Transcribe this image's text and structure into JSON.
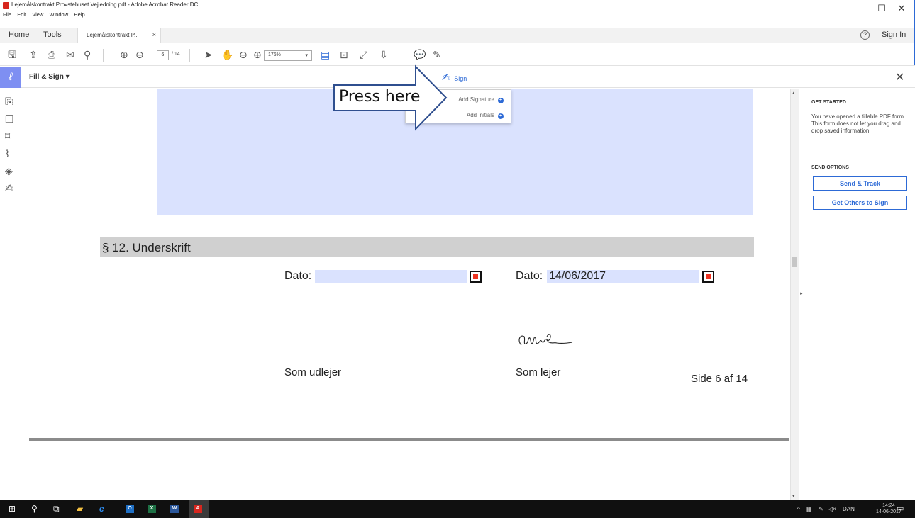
{
  "window": {
    "title": "Lejemålskontrakt Provstehuset Vejledning.pdf - Adobe Acrobat Reader DC",
    "min": "–",
    "max": "☐",
    "close": "✕"
  },
  "menu": [
    "File",
    "Edit",
    "View",
    "Window",
    "Help"
  ],
  "tabs": {
    "home": "Home",
    "tools": "Tools",
    "doc_tab": "Lejemålskontrakt P...",
    "doc_tab_close": "×",
    "help": "?",
    "sign_in": "Sign In"
  },
  "toolbar": {
    "page_current": "6",
    "page_total": "/ 14",
    "zoom": "176%",
    "zoom_arrow": "▾"
  },
  "fill_sign": {
    "tool_label": "Fill & Sign ▾",
    "sign_label": "Sign",
    "close": "✕"
  },
  "sign_menu": {
    "add_signature": "Add Signature",
    "add_initials": "Add Initials"
  },
  "callout": {
    "text": "Press here"
  },
  "document": {
    "section_title": "§ 12.  Underskrift",
    "dato_label_left": "Dato:",
    "dato_value_left": "",
    "dato_label_right": "Dato:",
    "dato_value_right": "14/06/2017",
    "caption_left": "Som udlejer",
    "caption_right": "Som lejer",
    "page_footer": "Side 6 af 14"
  },
  "right_panel": {
    "get_started_title": "GET STARTED",
    "get_started_text": "You have opened a fillable PDF form. This form does not let you drag and drop saved information.",
    "send_options_title": "SEND OPTIONS",
    "send_track": "Send & Track",
    "get_others": "Get Others to Sign"
  },
  "taskbar": {
    "tray_lang": "DAN",
    "time": "14:24",
    "date": "14-06-2017",
    "outlook": "O",
    "excel": "X",
    "word": "W",
    "acrobat": "A"
  },
  "colors": {
    "accent": "#2d6ad6",
    "field_fill": "#dae2fe",
    "tool_purple": "#7e8ff2",
    "section_gray": "#d0d0d0"
  }
}
